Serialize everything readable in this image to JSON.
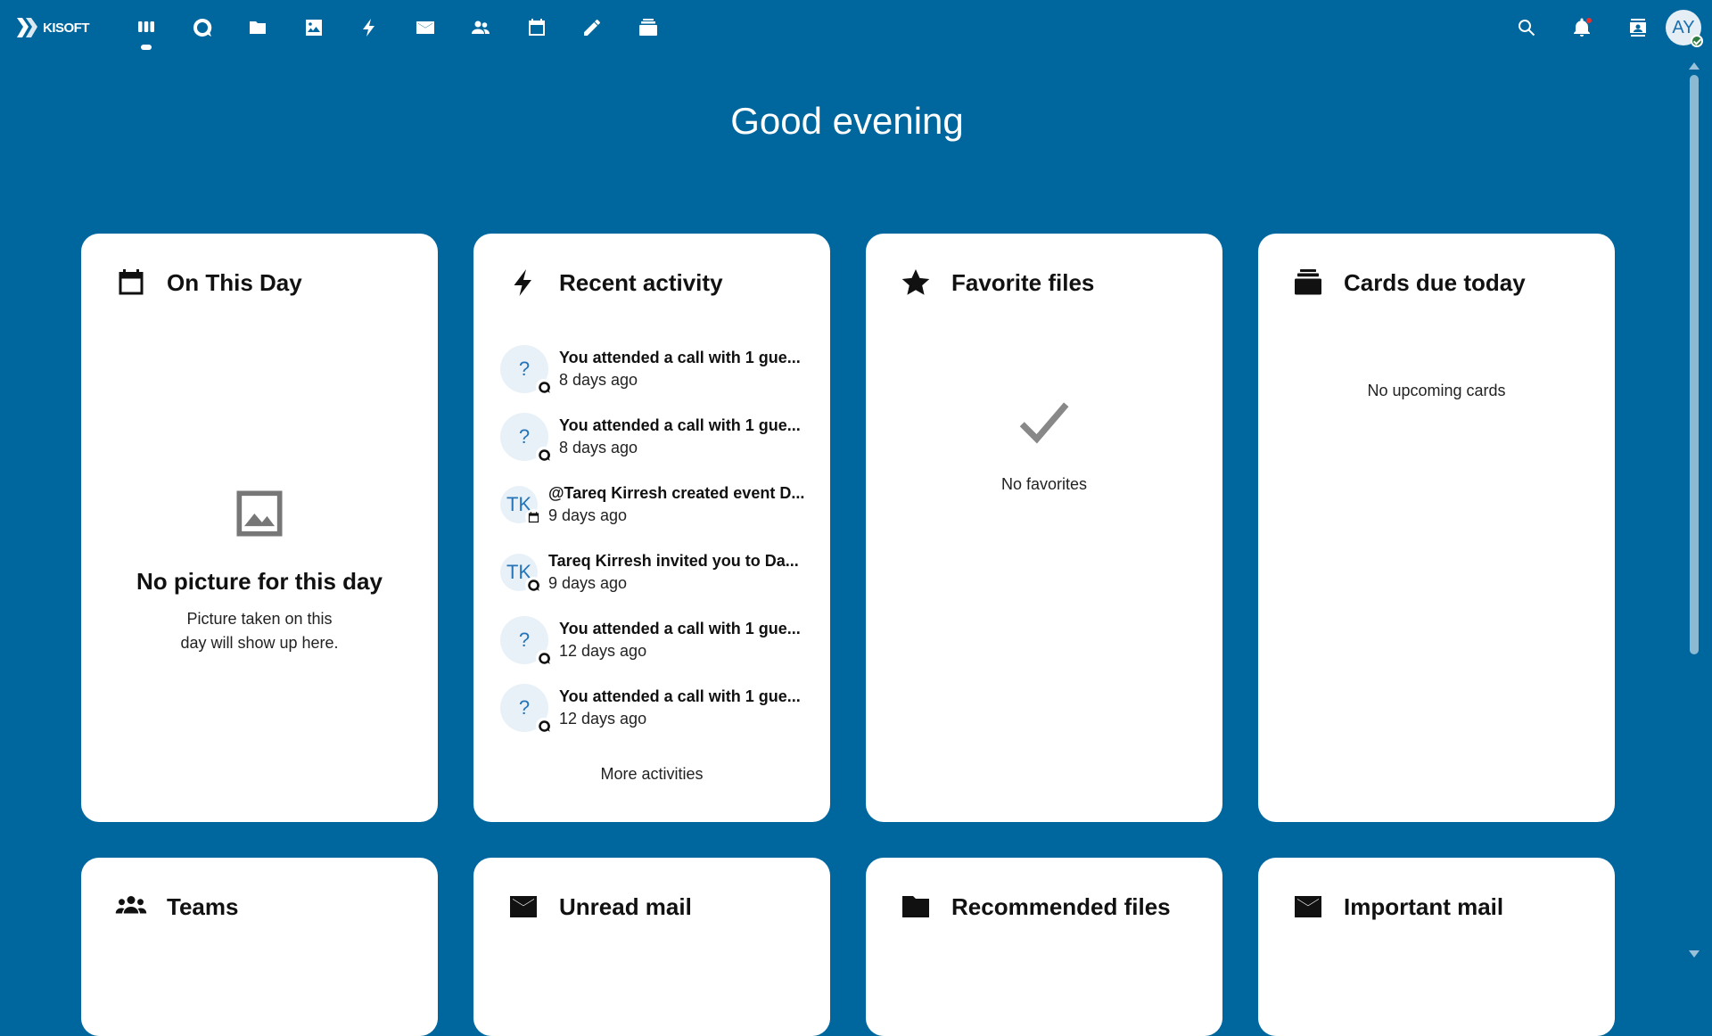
{
  "brand": {
    "name": "KISOFT",
    "logo_icon": "kisoft-logo-icon"
  },
  "apps": [
    {
      "name": "dashboard",
      "icon": "dashboard-icon",
      "active": true
    },
    {
      "name": "talk",
      "icon": "talk-icon"
    },
    {
      "name": "files",
      "icon": "folder-icon"
    },
    {
      "name": "photos",
      "icon": "image-icon"
    },
    {
      "name": "activity",
      "icon": "lightning-icon"
    },
    {
      "name": "mail",
      "icon": "mail-icon"
    },
    {
      "name": "contacts",
      "icon": "contacts-icon"
    },
    {
      "name": "calendar",
      "icon": "calendar-icon"
    },
    {
      "name": "notes",
      "icon": "pencil-icon"
    },
    {
      "name": "deck",
      "icon": "deck-icon"
    }
  ],
  "header_right": {
    "avatar_initials": "AY"
  },
  "greeting": "Good evening",
  "widgets": {
    "on_this_day": {
      "title": "On This Day",
      "empty_title": "No picture for this day",
      "empty_line1": "Picture taken on this",
      "empty_line2": "day will show up here."
    },
    "recent_activity": {
      "title": "Recent activity",
      "items": [
        {
          "avatar": "?",
          "badge": "talk-icon",
          "title": "You attended a call with 1 gue...",
          "time": "8 days ago"
        },
        {
          "avatar": "?",
          "badge": "talk-icon",
          "title": "You attended a call with 1 gue...",
          "time": "8 days ago"
        },
        {
          "avatar": "TK",
          "badge": "calendar-icon",
          "title": "@Tareq Kirresh created event D...",
          "time": "9 days ago"
        },
        {
          "avatar": "TK",
          "badge": "talk-icon",
          "title": "Tareq Kirresh invited you to Da...",
          "time": "9 days ago"
        },
        {
          "avatar": "?",
          "badge": "talk-icon",
          "title": "You attended a call with 1 gue...",
          "time": "12 days ago"
        },
        {
          "avatar": "?",
          "badge": "talk-icon",
          "title": "You attended a call with 1 gue...",
          "time": "12 days ago"
        }
      ],
      "more_label": "More activities"
    },
    "favorite_files": {
      "title": "Favorite files",
      "empty_text": "No favorites"
    },
    "cards_due": {
      "title": "Cards due today",
      "empty_text": "No upcoming cards"
    },
    "teams": {
      "title": "Teams"
    },
    "unread_mail": {
      "title": "Unread mail"
    },
    "recommended_files": {
      "title": "Recommended files"
    },
    "important_mail": {
      "title": "Important mail"
    }
  }
}
